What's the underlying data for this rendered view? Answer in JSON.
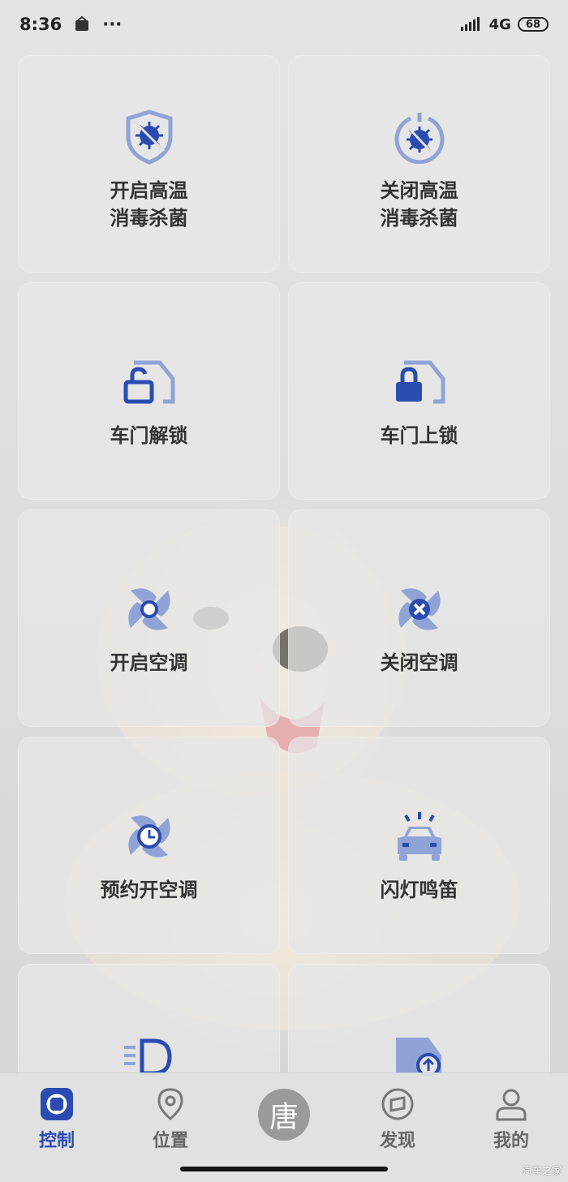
{
  "status_bar": {
    "time": "8:36",
    "dots": "···",
    "network": "4G",
    "battery": "68"
  },
  "cards": [
    {
      "label_line1": "开启高温",
      "label_line2": "消毒杀菌",
      "icon": "shield-virus-icon"
    },
    {
      "label_line1": "关闭高温",
      "label_line2": "消毒杀菌",
      "icon": "power-virus-icon"
    },
    {
      "label_line1": "车门解锁",
      "label_line2": "",
      "icon": "door-unlock-icon"
    },
    {
      "label_line1": "车门上锁",
      "label_line2": "",
      "icon": "door-lock-icon"
    },
    {
      "label_line1": "开启空调",
      "label_line2": "",
      "icon": "fan-on-icon"
    },
    {
      "label_line1": "关闭空调",
      "label_line2": "",
      "icon": "fan-off-icon"
    },
    {
      "label_line1": "预约开空调",
      "label_line2": "",
      "icon": "fan-clock-icon"
    },
    {
      "label_line1": "闪灯鸣笛",
      "label_line2": "",
      "icon": "car-flash-icon"
    }
  ],
  "tabs": [
    {
      "label": "控制",
      "icon": "control-icon",
      "active": true
    },
    {
      "label": "位置",
      "icon": "location-icon",
      "active": false
    },
    {
      "label": "发现",
      "icon": "discover-icon",
      "active": false
    },
    {
      "label": "我的",
      "icon": "profile-icon",
      "active": false
    }
  ],
  "center_button": {
    "label": "唐"
  },
  "watermark": "汽车之家",
  "colors": {
    "accent": "#2a4bb0",
    "icon_light": "#8fa3d6"
  }
}
